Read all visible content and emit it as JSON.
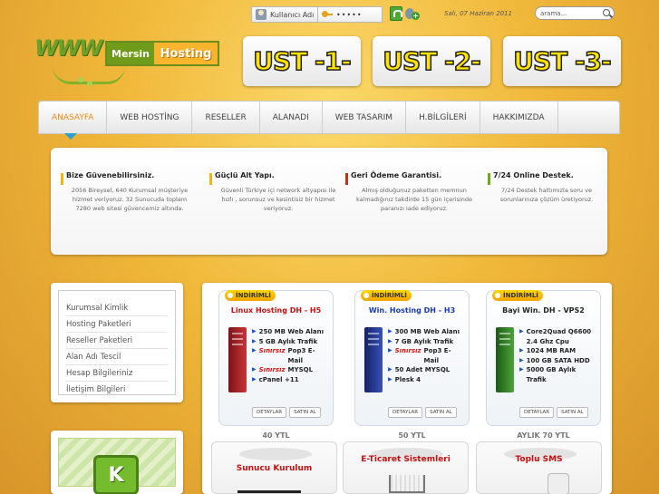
{
  "topbar": {
    "username_placeholder": "Kullanıcı Adı",
    "password_masked": "•••••",
    "date": "Salı, 07 Haziran 2011",
    "search_placeholder": "arama..."
  },
  "logo": {
    "www": "WWW",
    "mersin": "Mersin",
    "hosting": "Hosting"
  },
  "banners": [
    "UST -1-",
    "UST -2-",
    "UST -3-"
  ],
  "nav": {
    "items": [
      "ANASAYFA",
      "WEB HOSTİNG",
      "RESELLER",
      "ALANADI",
      "WEB TASARIM",
      "H.BİLGİLERİ",
      "HAKKIMIZDA"
    ],
    "active": "ANASAYFA"
  },
  "info": [
    {
      "title": "Bize Güvenebilirsiniz.",
      "text": "2056 Bireysel, 640 Kurumsal müşteriye hizmet veriyoruz. 32 Sunucuda toplam 7280 web sitesi güvencemiz altında.",
      "color": "#f2b514"
    },
    {
      "title": "Güçlü Alt Yapı.",
      "text": "Güvenli Türkiye içi network altyapısı ile hızlı , sorunsuz ve kesintisiz bir hizmet veriyoruz.",
      "color": "#f2b514"
    },
    {
      "title": "Geri Ödeme Garantisi.",
      "text": "Almış olduğunuz paketten memnun kalmadığınız takdirde 15 gün içerisinde paranızı iade ediyoruz.",
      "color": "#d12b16"
    },
    {
      "title": "7/24 Online Destek.",
      "text": "7/24 Destek hattımızla soru ve sorunlarınıza çözüm üretiyoruz.",
      "color": "#6aaa1e"
    }
  ],
  "sidebar": {
    "items": [
      "Kurumsal Kimlik",
      "Hosting Paketleri",
      "Reseller Paketleri",
      "Alan Adı Tescil",
      "Hesap Bilgileriniz",
      "İletişim Bilgileri"
    ],
    "tile_letter": "K"
  },
  "cards": [
    {
      "badge": "İNDİRİMLİ",
      "title": "Linux Hosting DH - H5",
      "title_color": "#c41010",
      "server_color": "#b3242a",
      "features": [
        {
          "text": "250 MB Web Alanı"
        },
        {
          "text": "5 GB Aylık Trafik"
        },
        {
          "prefix": "Sınırsız",
          "text": "Pop3 E-Mail"
        },
        {
          "prefix": "Sınırsız",
          "text": "MYSQL"
        },
        {
          "text": "cPanel +11"
        }
      ],
      "details": "DETAYLAR",
      "buy": "SATIN AL",
      "price": "40 YTL"
    },
    {
      "badge": "İNDİRİMLİ",
      "title": "Win. Hosting  DH - H3",
      "title_color": "#1a3bb0",
      "server_color": "#2a3f9e",
      "features": [
        {
          "text": "300 MB Web Alanı"
        },
        {
          "text": "7 GB Aylık Trafik"
        },
        {
          "prefix": "Sınırsız",
          "text": "Pop3 E-Mail"
        },
        {
          "text": "50 Adet MYSQL"
        },
        {
          "text": "Plesk 4"
        }
      ],
      "details": "DETAYLAR",
      "buy": "SATIN AL",
      "price": "50 YTL"
    },
    {
      "badge": "İNDİRİMLİ",
      "title": "Bayi Win.  DH - VPS2",
      "title_color": "#222222",
      "server_color": "#3a8a2a",
      "features": [
        {
          "text": "Core2Quad Q6600 2.4 Ghz Cpu"
        },
        {
          "text": "1024 MB RAM"
        },
        {
          "text": "100 GB SATA HDD"
        },
        {
          "text": "5000 GB Aylık Trafik"
        }
      ],
      "details": "DETAYLAR",
      "buy": "SATIN AL",
      "price": "AYLIK 70 YTL"
    }
  ],
  "bottom_cards": [
    "Sunucu Kurulum",
    "E-Ticaret Sistemleri",
    "Toplu SMS"
  ]
}
